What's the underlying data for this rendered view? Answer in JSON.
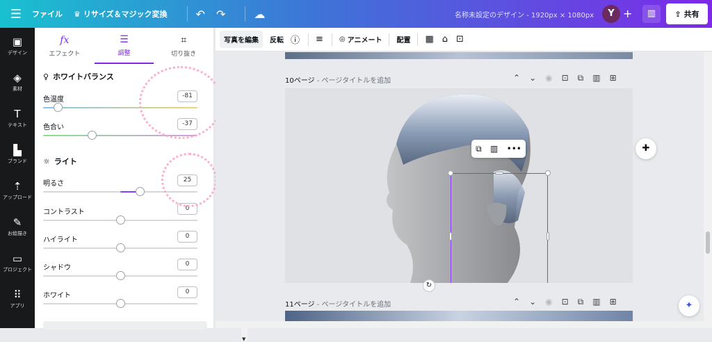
{
  "topbar": {
    "file": "ファイル",
    "resize": "リサイズ＆マジック変換",
    "doc_title": "名称未設定のデザイン - 1920px × 1080px",
    "avatar": "Y",
    "share": "共有"
  },
  "rail": [
    {
      "icon": "layout-icon",
      "label": "デザイン"
    },
    {
      "icon": "elements-icon",
      "label": "素材"
    },
    {
      "icon": "text-icon",
      "label": "テキスト"
    },
    {
      "icon": "brand-icon",
      "label": "ブランド"
    },
    {
      "icon": "upload-icon",
      "label": "アップロード"
    },
    {
      "icon": "draw-icon",
      "label": "お絵描き"
    },
    {
      "icon": "folder-icon",
      "label": "プロジェクト"
    },
    {
      "icon": "apps-icon",
      "label": "アプリ"
    }
  ],
  "panel": {
    "tabs": [
      {
        "icon": "fx",
        "label": "エフェクト"
      },
      {
        "icon": "adjust",
        "label": "調整"
      },
      {
        "icon": "crop",
        "label": "切り抜き"
      }
    ],
    "white_balance": {
      "title": "ホワイトバランス",
      "rows": [
        {
          "label": "色温度",
          "value": "-81",
          "level": 0.095
        },
        {
          "label": "色合い",
          "value": "-37",
          "level": 0.315
        }
      ]
    },
    "light": {
      "title": "ライト",
      "rows": [
        {
          "label": "明るさ",
          "value": "25",
          "level": 0.625
        },
        {
          "label": "コントラスト",
          "value": "0",
          "level": 0.5
        },
        {
          "label": "ハイライト",
          "value": "0",
          "level": 0.5
        },
        {
          "label": "シャドウ",
          "value": "0",
          "level": 0.5
        },
        {
          "label": "ホワイト",
          "value": "0",
          "level": 0.5
        }
      ]
    }
  },
  "toolbar": {
    "edit_photo": "写真を編集",
    "flip": "反転",
    "animate": "アニメート",
    "position": "配置"
  },
  "pages": {
    "page10_num": "10ページ",
    "page10_sub": " - ページタイトルを追加",
    "page11_num": "11ページ",
    "page11_sub": " - ページタイトルを追加"
  }
}
